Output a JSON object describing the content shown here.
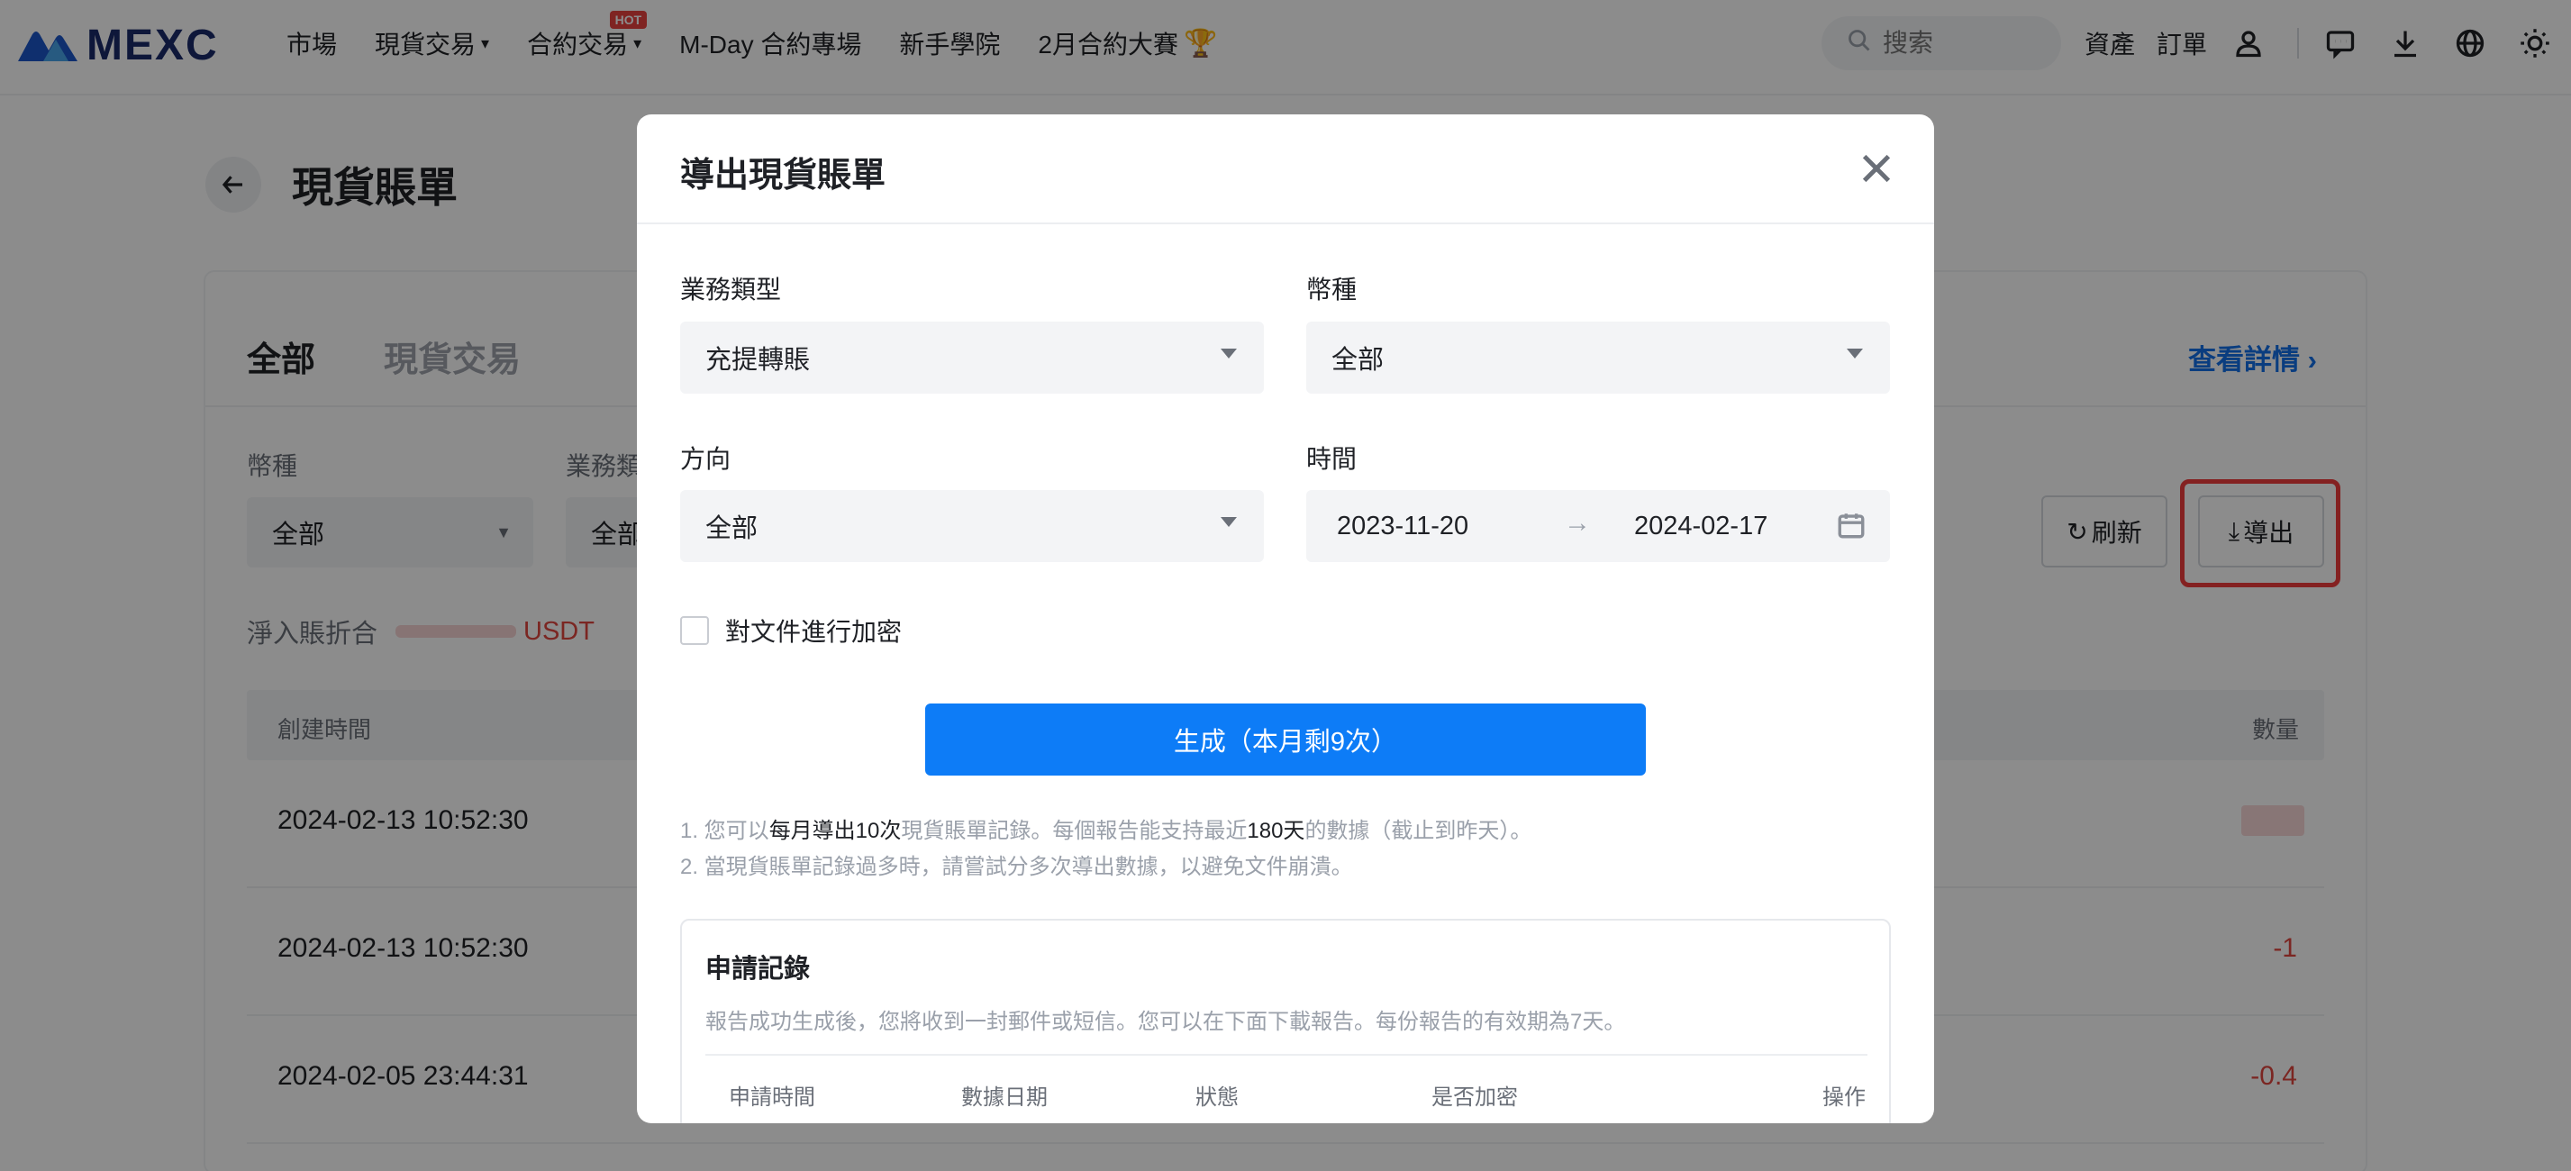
{
  "brand": {
    "name": "MEXC"
  },
  "nav": {
    "items": [
      {
        "label": "市場",
        "has_caret": false
      },
      {
        "label": "現貨交易",
        "has_caret": true
      },
      {
        "label": "合約交易",
        "has_caret": true,
        "badge": "HOT"
      },
      {
        "label": "M-Day 合約專場",
        "has_caret": false
      },
      {
        "label": "新手學院",
        "has_caret": false
      },
      {
        "label": "2月合約大賽",
        "has_caret": false,
        "icon": "trophy-icon"
      }
    ],
    "search_placeholder": "搜索",
    "assets_label": "資產",
    "orders_label": "訂單",
    "icons": [
      "user-icon",
      "chat-icon",
      "download-icon",
      "globe-icon",
      "sun-icon"
    ]
  },
  "page": {
    "title": "現貨賬單",
    "tabs": [
      "全部",
      "現貨交易"
    ],
    "detail_link": "查看詳情",
    "filters": {
      "currency_label": "幣種",
      "currency_value": "全部",
      "business_label": "業務類",
      "business_value": "全部"
    },
    "refresh_label": "刷新",
    "export_label": "導出",
    "net_label": "淨入賬折合",
    "net_unit": "USDT",
    "table": {
      "col_time": "創建時間",
      "col_amount": "數量",
      "rows": [
        {
          "time": "2024-02-13 10:52:30",
          "amount": ""
        },
        {
          "time": "2024-02-13 10:52:30",
          "amount": "-1"
        },
        {
          "time": "2024-02-05 23:44:31",
          "amount": "-0.4"
        }
      ]
    }
  },
  "modal": {
    "title": "導出現貨賬單",
    "business_type_label": "業務類型",
    "business_type_value": "充提轉賬",
    "currency_label": "幣種",
    "currency_value": "全部",
    "direction_label": "方向",
    "direction_value": "全部",
    "time_label": "時間",
    "date_start": "2023-11-20",
    "date_end": "2024-02-17",
    "encrypt_label": "對文件進行加密",
    "encrypt_checked": false,
    "generate_label": "生成（本月剩9次）",
    "notes": {
      "n1_a": "1. 您可以",
      "n1_b": "每月導出10次",
      "n1_c": "現貨賬單記錄。每個報告能支持最近",
      "n1_d": "180天",
      "n1_e": "的數據（截止到昨天）。",
      "n2": "2. 當現貨賬單記錄過多時，請嘗試分多次導出數據，以避免文件崩潰。"
    },
    "records": {
      "title": "申請記錄",
      "description": "報告成功生成後，您將收到一封郵件或短信。您可以在下面下載報告。每份報告的有效期為7天。",
      "columns": [
        "申請時間",
        "數據日期",
        "狀態",
        "是否加密",
        "操作"
      ]
    }
  },
  "colors": {
    "accent": "#0d7cf7",
    "link": "#1370e8",
    "negative": "#e0453e",
    "highlight": "#f03c3c",
    "hot_badge": "#e8423f"
  }
}
